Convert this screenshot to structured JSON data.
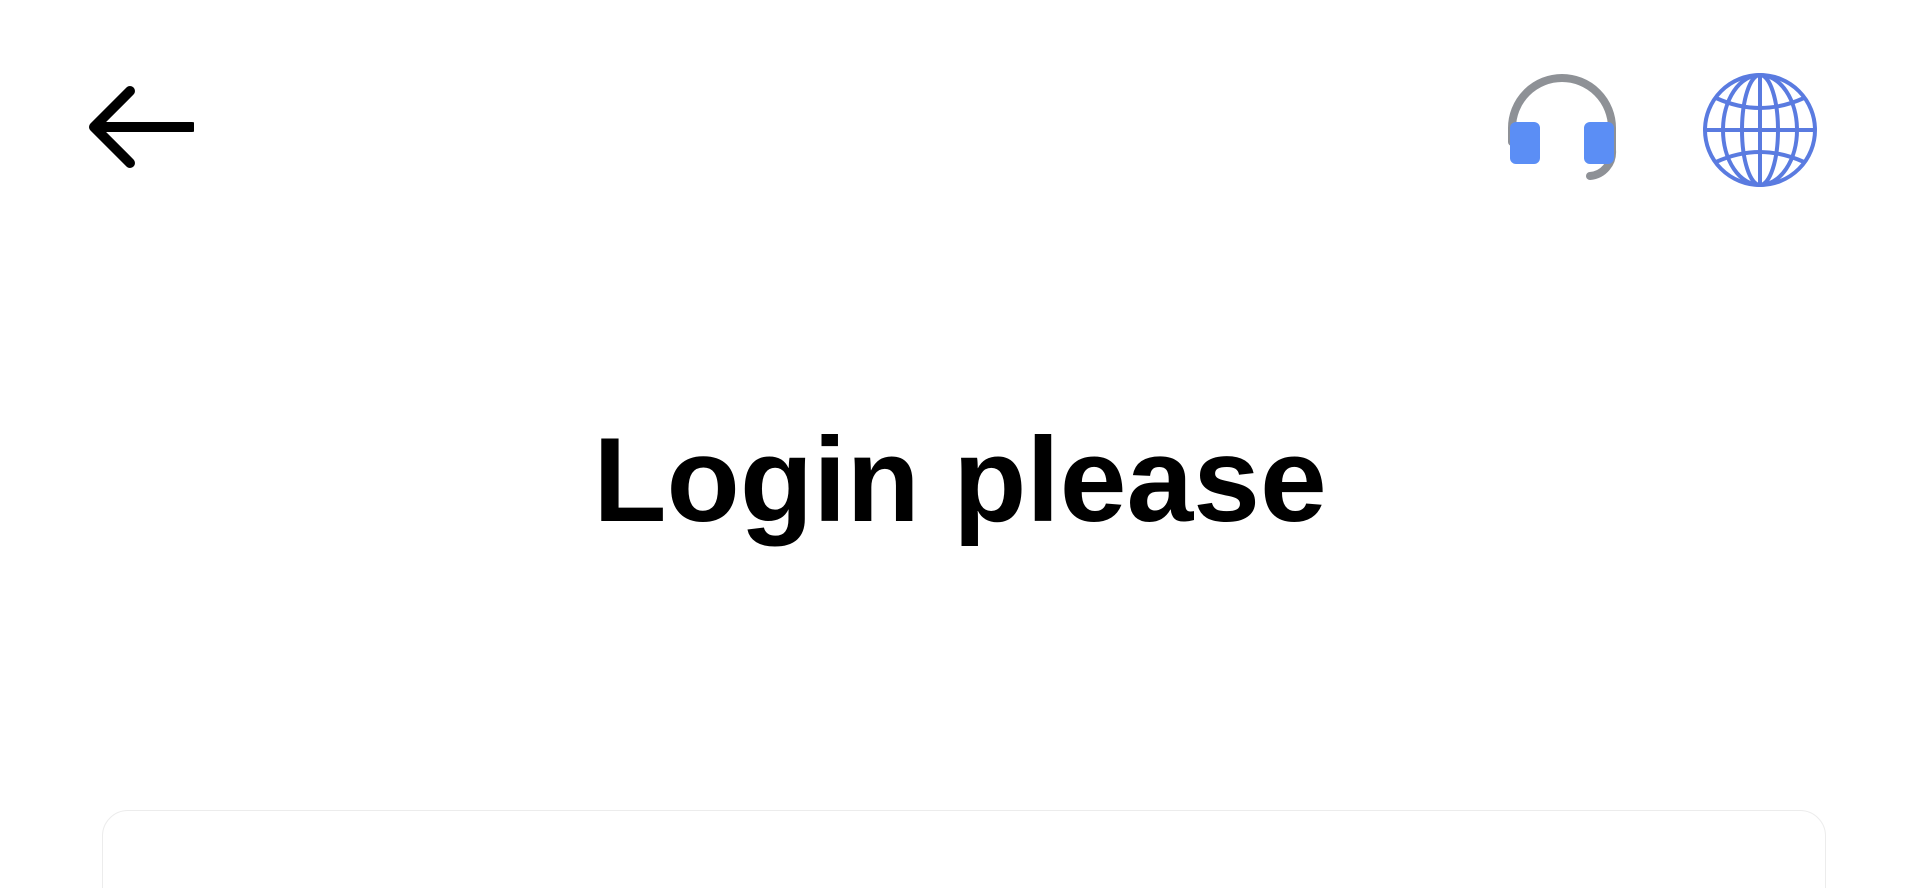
{
  "header": {
    "back_icon": "arrow-left-icon",
    "support_icon": "headset-icon",
    "language_icon": "globe-icon"
  },
  "main": {
    "title": "Login please"
  },
  "colors": {
    "icon_dark": "#000000",
    "headset_band": "#8e9196",
    "headset_ear": "#5b8ef5",
    "globe": "#5a7be0",
    "card_border": "#ececec"
  }
}
